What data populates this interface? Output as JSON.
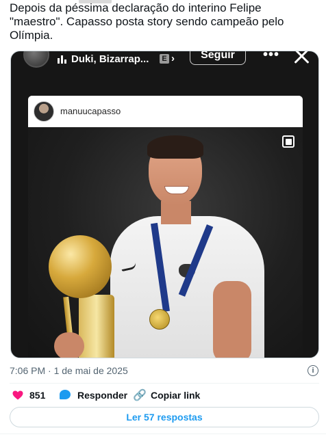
{
  "tweet": {
    "text_line1": "Depois da péssima declaração do interino Felipe",
    "text_line2": "\"maestro\". Capasso posta story sendo campeão pelo",
    "text_line3": "Olímpia."
  },
  "story": {
    "music_label": "Duki, Bizarrap...",
    "explicit_badge": "E",
    "follow_button": "Seguir",
    "more_label": "•••"
  },
  "post": {
    "username": "manuucapasso"
  },
  "meta": {
    "timestamp": "7:06 PM · 1 de mai de 2025",
    "info_icon": "i"
  },
  "actions": {
    "like_count": "851",
    "reply_label": "Responder",
    "copy_link_label": "Copiar link",
    "read_replies": "Ler 57 respostas"
  },
  "icons": {
    "heart": "heart-icon",
    "reply": "reply-bubble-icon",
    "link": "link-icon",
    "info": "info-icon",
    "close": "close-icon",
    "music": "music-bars-icon",
    "carousel": "carousel-icon"
  },
  "colors": {
    "accent": "#1d9bf0",
    "like": "#f91880",
    "text": "#0f1419",
    "muted": "#536471"
  }
}
